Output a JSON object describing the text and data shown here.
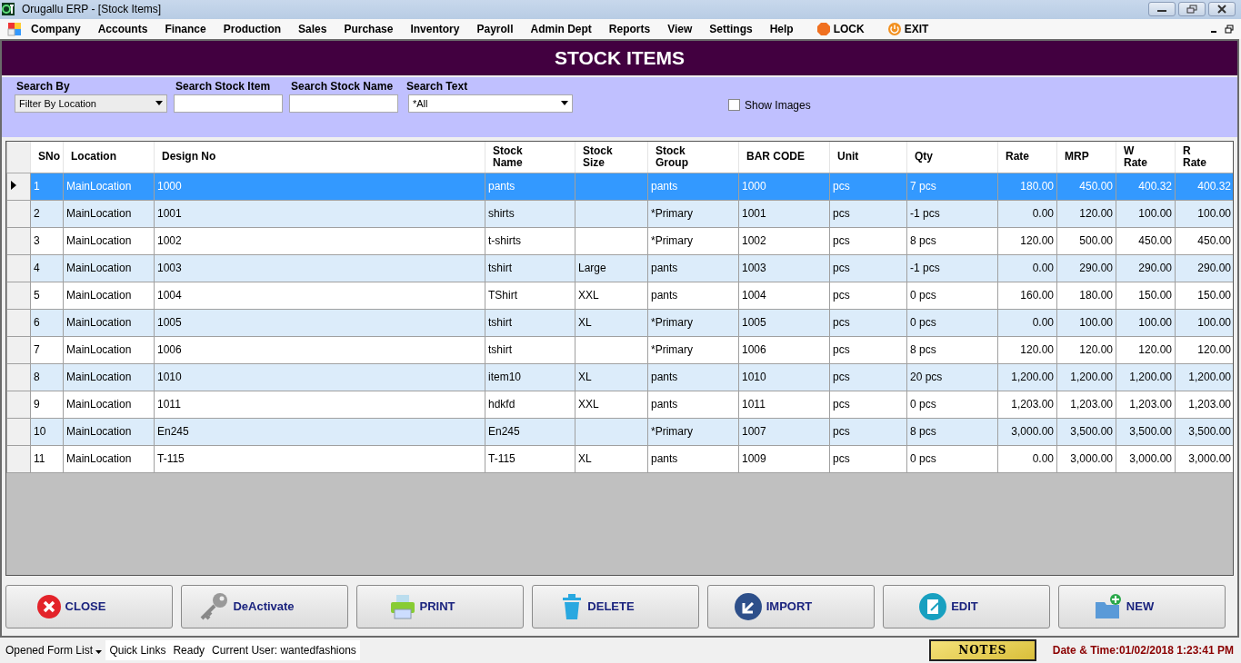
{
  "window": {
    "title": "Orugallu ERP - [Stock Items]"
  },
  "menu": [
    {
      "label": "Company",
      "kind": "menu"
    },
    {
      "label": "Accounts",
      "kind": "menu"
    },
    {
      "label": "Finance",
      "kind": "menu"
    },
    {
      "label": "Production",
      "kind": "menu"
    },
    {
      "label": "Sales",
      "kind": "menu"
    },
    {
      "label": "Purchase",
      "kind": "menu"
    },
    {
      "label": "Inventory",
      "kind": "menu"
    },
    {
      "label": "Payroll",
      "kind": "menu"
    },
    {
      "label": "Admin Dept",
      "kind": "menu"
    },
    {
      "label": "Reports",
      "kind": "menu"
    },
    {
      "label": "View",
      "kind": "menu"
    },
    {
      "label": "Settings",
      "kind": "menu"
    },
    {
      "label": "Help",
      "kind": "menu"
    },
    {
      "label": "LOCK",
      "kind": "lock"
    },
    {
      "label": "EXIT",
      "kind": "exit"
    }
  ],
  "page_title": "STOCK ITEMS",
  "filters": {
    "search_by": {
      "label": "Search By",
      "value": "Filter By Location"
    },
    "search_stock_item": {
      "label": "Search Stock Item"
    },
    "search_stock_name": {
      "label": "Search Stock Name"
    },
    "search_text": {
      "label": "Search Text",
      "value": "*All"
    },
    "show_images": {
      "label": "Show Images",
      "checked": false
    }
  },
  "table": {
    "columns": [
      {
        "label": "SNo",
        "kind": "text"
      },
      {
        "label": "Location",
        "kind": "text"
      },
      {
        "label": "Design No",
        "kind": "text"
      },
      {
        "label": "Stock\nName",
        "kind": "text"
      },
      {
        "label": "Stock\nSize",
        "kind": "text"
      },
      {
        "label": "Stock\nGroup",
        "kind": "text"
      },
      {
        "label": "BAR CODE",
        "kind": "text"
      },
      {
        "label": "Unit",
        "kind": "text"
      },
      {
        "label": "Qty",
        "kind": "text"
      },
      {
        "label": "Rate",
        "kind": "number"
      },
      {
        "label": "MRP",
        "kind": "number"
      },
      {
        "label": "W\nRate",
        "kind": "number"
      },
      {
        "label": "R\nRate",
        "kind": "number"
      }
    ],
    "rows": [
      {
        "selected": true,
        "cells": [
          "1",
          "MainLocation",
          "1000",
          "pants",
          "",
          "pants",
          "1000",
          "pcs",
          "7 pcs",
          "180.00",
          "450.00",
          "400.32",
          "400.32"
        ]
      },
      {
        "selected": false,
        "cells": [
          "2",
          "MainLocation",
          "1001",
          "shirts",
          "",
          "*Primary",
          "1001",
          "pcs",
          "-1 pcs",
          "0.00",
          "120.00",
          "100.00",
          "100.00"
        ]
      },
      {
        "selected": false,
        "cells": [
          "3",
          "MainLocation",
          "1002",
          "t-shirts",
          "",
          "*Primary",
          "1002",
          "pcs",
          "8 pcs",
          "120.00",
          "500.00",
          "450.00",
          "450.00"
        ]
      },
      {
        "selected": false,
        "cells": [
          "4",
          "MainLocation",
          "1003",
          "tshirt",
          "Large",
          "pants",
          "1003",
          "pcs",
          "-1 pcs",
          "0.00",
          "290.00",
          "290.00",
          "290.00"
        ]
      },
      {
        "selected": false,
        "cells": [
          "5",
          "MainLocation",
          "1004",
          "TShirt",
          "XXL",
          "pants",
          "1004",
          "pcs",
          "0 pcs",
          "160.00",
          "180.00",
          "150.00",
          "150.00"
        ]
      },
      {
        "selected": false,
        "cells": [
          "6",
          "MainLocation",
          "1005",
          "tshirt",
          "XL",
          "*Primary",
          "1005",
          "pcs",
          "0 pcs",
          "0.00",
          "100.00",
          "100.00",
          "100.00"
        ]
      },
      {
        "selected": false,
        "cells": [
          "7",
          "MainLocation",
          "1006",
          "tshirt",
          "",
          "*Primary",
          "1006",
          "pcs",
          "8 pcs",
          "120.00",
          "120.00",
          "120.00",
          "120.00"
        ]
      },
      {
        "selected": false,
        "cells": [
          "8",
          "MainLocation",
          "1010",
          "item10",
          "XL",
          "pants",
          "1010",
          "pcs",
          "20 pcs",
          "1,200.00",
          "1,200.00",
          "1,200.00",
          "1,200.00"
        ]
      },
      {
        "selected": false,
        "cells": [
          "9",
          "MainLocation",
          "1011",
          "hdkfd",
          "XXL",
          "pants",
          "1011",
          "pcs",
          "0 pcs",
          "1,203.00",
          "1,203.00",
          "1,203.00",
          "1,203.00"
        ]
      },
      {
        "selected": false,
        "cells": [
          "10",
          "MainLocation",
          "En245",
          "En245",
          "",
          "*Primary",
          "1007",
          "pcs",
          "8 pcs",
          "3,000.00",
          "3,500.00",
          "3,500.00",
          "3,500.00"
        ]
      },
      {
        "selected": false,
        "cells": [
          "11",
          "MainLocation",
          "T-115",
          "T-115",
          "XL",
          "pants",
          "1009",
          "pcs",
          "0 pcs",
          "0.00",
          "3,000.00",
          "3,000.00",
          "3,000.00"
        ]
      }
    ]
  },
  "buttons": [
    {
      "label": "CLOSE",
      "kind": "close"
    },
    {
      "label": "DeActivate",
      "kind": "key"
    },
    {
      "label": "PRINT",
      "kind": "print"
    },
    {
      "label": "DELETE",
      "kind": "delete"
    },
    {
      "label": "IMPORT",
      "kind": "import"
    },
    {
      "label": "EDIT",
      "kind": "edit"
    },
    {
      "label": "NEW",
      "kind": "new"
    }
  ],
  "status_bar": {
    "opened_form_list": "Opened Form List",
    "quick_links": "Quick Links",
    "status": "Ready",
    "current_user": "Current User: wantedfashions",
    "notes": "NOTES",
    "date_time": "Date & Time:01/02/2018 1:23:41 PM"
  }
}
